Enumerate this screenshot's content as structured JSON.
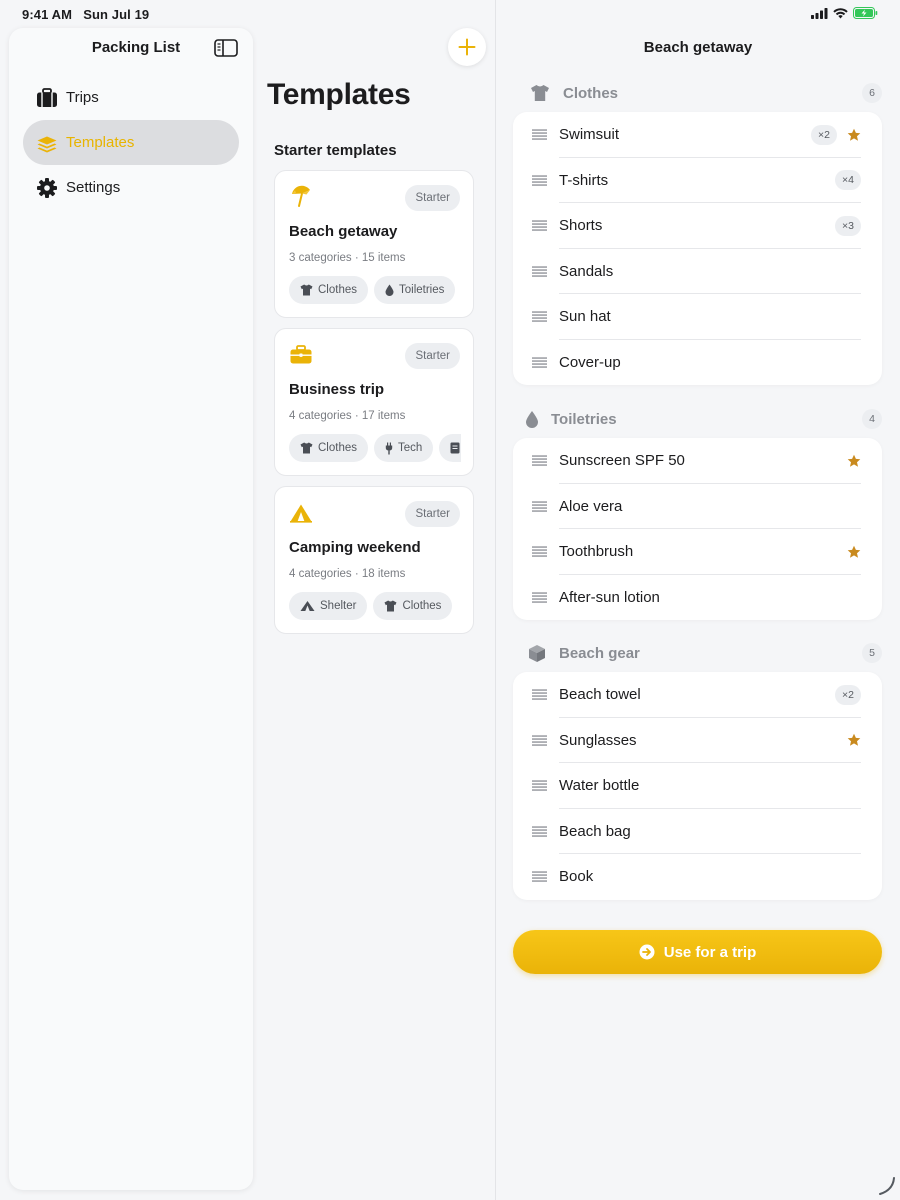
{
  "status_bar": {
    "time": "9:41 AM",
    "date": "Sun Jul 19"
  },
  "sidebar": {
    "title": "Packing List",
    "toggle_icon": "sidebar-toggle-icon",
    "items": [
      {
        "label": "Trips",
        "icon": "suitcase-icon",
        "active": false
      },
      {
        "label": "Templates",
        "icon": "layers-icon",
        "active": true
      },
      {
        "label": "Settings",
        "icon": "gear-icon",
        "active": false
      }
    ]
  },
  "templates": {
    "title": "Templates",
    "section": "Starter templates",
    "cards": [
      {
        "name": "Beach getaway",
        "badge": "Starter",
        "meta": "3 categories · 15 items",
        "icon": "beach-umbrella-icon",
        "chips": [
          {
            "label": "Clothes",
            "icon": "tshirt-icon"
          },
          {
            "label": "Toiletries",
            "icon": "drop-icon"
          }
        ]
      },
      {
        "name": "Business trip",
        "badge": "Starter",
        "meta": "4 categories · 17 items",
        "icon": "briefcase-icon",
        "chips": [
          {
            "label": "Clothes",
            "icon": "tshirt-icon"
          },
          {
            "label": "Tech",
            "icon": "plug-icon"
          },
          {
            "label": "",
            "icon": "document-icon"
          }
        ]
      },
      {
        "name": "Camping weekend",
        "badge": "Starter",
        "meta": "4 categories · 18 items",
        "icon": "tent-icon",
        "chips": [
          {
            "label": "Shelter",
            "icon": "tent-icon"
          },
          {
            "label": "Clothes",
            "icon": "tshirt-icon"
          }
        ]
      }
    ]
  },
  "detail": {
    "title": "Beach getaway",
    "groups": [
      {
        "name": "Clothes",
        "count": "6",
        "icon": "tshirt-icon",
        "items": [
          {
            "name": "Swimsuit",
            "qty": "×2",
            "starred": true
          },
          {
            "name": "T-shirts",
            "qty": "×4",
            "starred": false
          },
          {
            "name": "Shorts",
            "qty": "×3",
            "starred": false
          },
          {
            "name": "Sandals",
            "qty": "",
            "starred": false
          },
          {
            "name": "Sun hat",
            "qty": "",
            "starred": false
          },
          {
            "name": "Cover-up",
            "qty": "",
            "starred": false
          }
        ]
      },
      {
        "name": "Toiletries",
        "count": "4",
        "icon": "drop-icon",
        "items": [
          {
            "name": "Sunscreen SPF 50",
            "qty": "",
            "starred": true
          },
          {
            "name": "Aloe vera",
            "qty": "",
            "starred": false
          },
          {
            "name": "Toothbrush",
            "qty": "",
            "starred": true
          },
          {
            "name": "After-sun lotion",
            "qty": "",
            "starred": false
          }
        ]
      },
      {
        "name": "Beach gear",
        "count": "5",
        "icon": "box-icon",
        "items": [
          {
            "name": "Beach towel",
            "qty": "×2",
            "starred": false
          },
          {
            "name": "Sunglasses",
            "qty": "",
            "starred": true
          },
          {
            "name": "Water bottle",
            "qty": "",
            "starred": false
          },
          {
            "name": "Beach bag",
            "qty": "",
            "starred": false
          },
          {
            "name": "Book",
            "qty": "",
            "starred": false
          }
        ]
      }
    ],
    "cta_label": "Use for a trip"
  },
  "colors": {
    "accent": "#eab308",
    "star": "#c98a1e",
    "muted": "#8a8d93"
  }
}
